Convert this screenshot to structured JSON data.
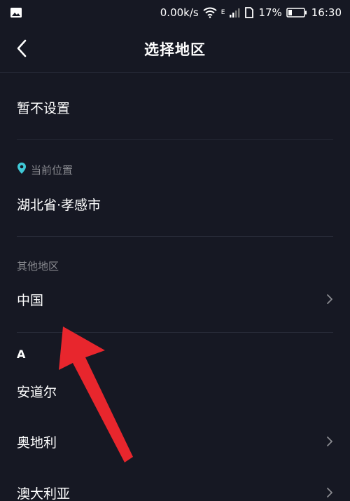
{
  "status_bar": {
    "speed": "0.00k/s",
    "network_type": "E",
    "battery_percent": "17%",
    "time": "16:30",
    "icons": [
      "image-icon",
      "wifi-icon",
      "signal-icon",
      "sim-icon",
      "battery-icon"
    ]
  },
  "header": {
    "title": "选择地区",
    "back_icon": "chevron-left-icon"
  },
  "options": {
    "not_set": "暂不设置"
  },
  "current_location": {
    "section_label": "当前位置",
    "icon": "location-pin-icon",
    "icon_color": "#3fc8d6",
    "value": "湖北省·孝感市"
  },
  "other_regions": {
    "section_label": "其他地区",
    "country": "中国"
  },
  "alpha_list": {
    "letter": "A",
    "items": [
      {
        "label": "安道尔",
        "has_chevron": false
      },
      {
        "label": "奥地利",
        "has_chevron": true
      },
      {
        "label": "澳大利亚",
        "has_chevron": true
      }
    ]
  },
  "colors": {
    "background": "#161823",
    "text_primary": "#ffffff",
    "text_secondary": "#8a8b91",
    "annotation_arrow": "#e8262d"
  }
}
